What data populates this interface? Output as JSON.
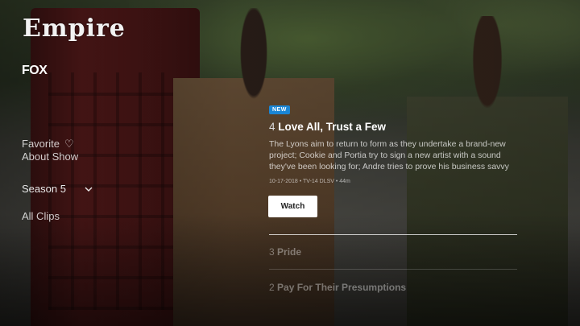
{
  "show": {
    "logo_text": "Empire",
    "network": "FOX"
  },
  "menu": {
    "favorite_label": "Favorite",
    "heart_icon": "♡",
    "about_label": "About Show",
    "season_label": "Season 5",
    "all_clips_label": "All Clips"
  },
  "featured_episode": {
    "badge": "NEW",
    "number": "4",
    "title": "Love All, Trust a Few",
    "description": "The Lyons aim to return to form as they undertake a brand-new project; Cookie and Portia try to sign a new artist with a sound they've been looking for; Andre tries to prove his business savvy",
    "meta": "10-17-2018 • TV-14 DLSV • 44m",
    "watch_label": "Watch",
    "progress": 0
  },
  "episodes": [
    {
      "number": "3",
      "title": "Pride"
    },
    {
      "number": "2",
      "title": "Pay For Their Presumptions"
    }
  ],
  "colors": {
    "badge": "#1a86d6",
    "button_bg": "#ffffff"
  }
}
